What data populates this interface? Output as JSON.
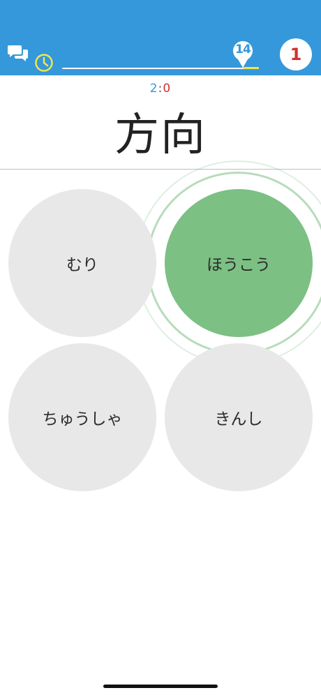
{
  "colors": {
    "header": "#3598db",
    "correct": "#7cc084",
    "option": "#e8e8e8",
    "player_one": "#3598db",
    "player_two": "#d0312d",
    "timer": "#f0e64a"
  },
  "header": {
    "chat_icon": "chat-bubbles-icon",
    "timer_icon": "clock-icon",
    "progress": {
      "remaining_count": "14",
      "elapsed_fraction": 0.92
    },
    "lives": "1"
  },
  "score": {
    "player_one": "2",
    "separator": ":",
    "player_two": "0"
  },
  "question": {
    "kanji": "方向"
  },
  "answers": [
    {
      "label": "むり",
      "state": "default"
    },
    {
      "label": "ほうこう",
      "state": "correct"
    },
    {
      "label": "ちゅうしゃ",
      "state": "default"
    },
    {
      "label": "きんし",
      "state": "default"
    }
  ]
}
